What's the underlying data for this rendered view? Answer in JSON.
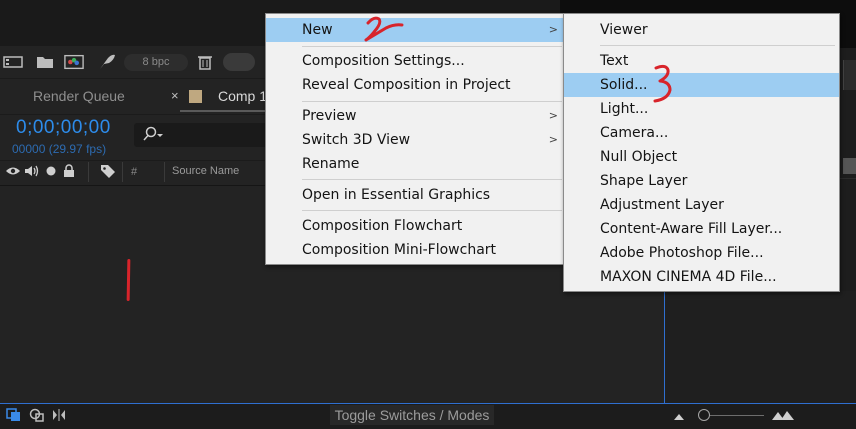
{
  "project_panel": {
    "bpc_label": "8 bpc"
  },
  "timeline": {
    "tabs": [
      {
        "label": "Render Queue"
      },
      {
        "label": "Comp 1"
      }
    ],
    "tab_close_glyph": "×",
    "timecode": "0;00;00;00",
    "fps": "00000 (29.97 fps)",
    "columns": {
      "hash": "#",
      "source_name": "Source Name"
    }
  },
  "context_menu": {
    "items": [
      {
        "label": "New",
        "submenu": true,
        "highlighted": true
      },
      {
        "label": "Composition Settings..."
      },
      {
        "label": "Reveal Composition in Project"
      },
      {
        "label": "Preview",
        "submenu": true
      },
      {
        "label": "Switch 3D View",
        "submenu": true
      },
      {
        "label": "Rename"
      },
      {
        "label": "Open in Essential Graphics"
      },
      {
        "label": "Composition Flowchart"
      },
      {
        "label": "Composition Mini-Flowchart"
      }
    ]
  },
  "submenu_new": {
    "items": [
      {
        "label": "Viewer"
      },
      {
        "label": "Text"
      },
      {
        "label": "Solid...",
        "highlighted": true
      },
      {
        "label": "Light..."
      },
      {
        "label": "Camera..."
      },
      {
        "label": "Null Object"
      },
      {
        "label": "Shape Layer"
      },
      {
        "label": "Adjustment Layer"
      },
      {
        "label": "Content-Aware Fill Layer..."
      },
      {
        "label": "Adobe Photoshop File..."
      },
      {
        "label": "MAXON CINEMA 4D File..."
      }
    ]
  },
  "bottom_bar": {
    "toggle_label": "Toggle Switches / Modes"
  },
  "annotations": {
    "step_2": "2",
    "step_3": "3"
  },
  "colors": {
    "accent_blue": "#2d8ceb",
    "menu_highlight": "#9dcdf2",
    "annotation_red": "#d8242b"
  },
  "icons": {
    "submenu_arrow": "chevron-right-icon"
  }
}
